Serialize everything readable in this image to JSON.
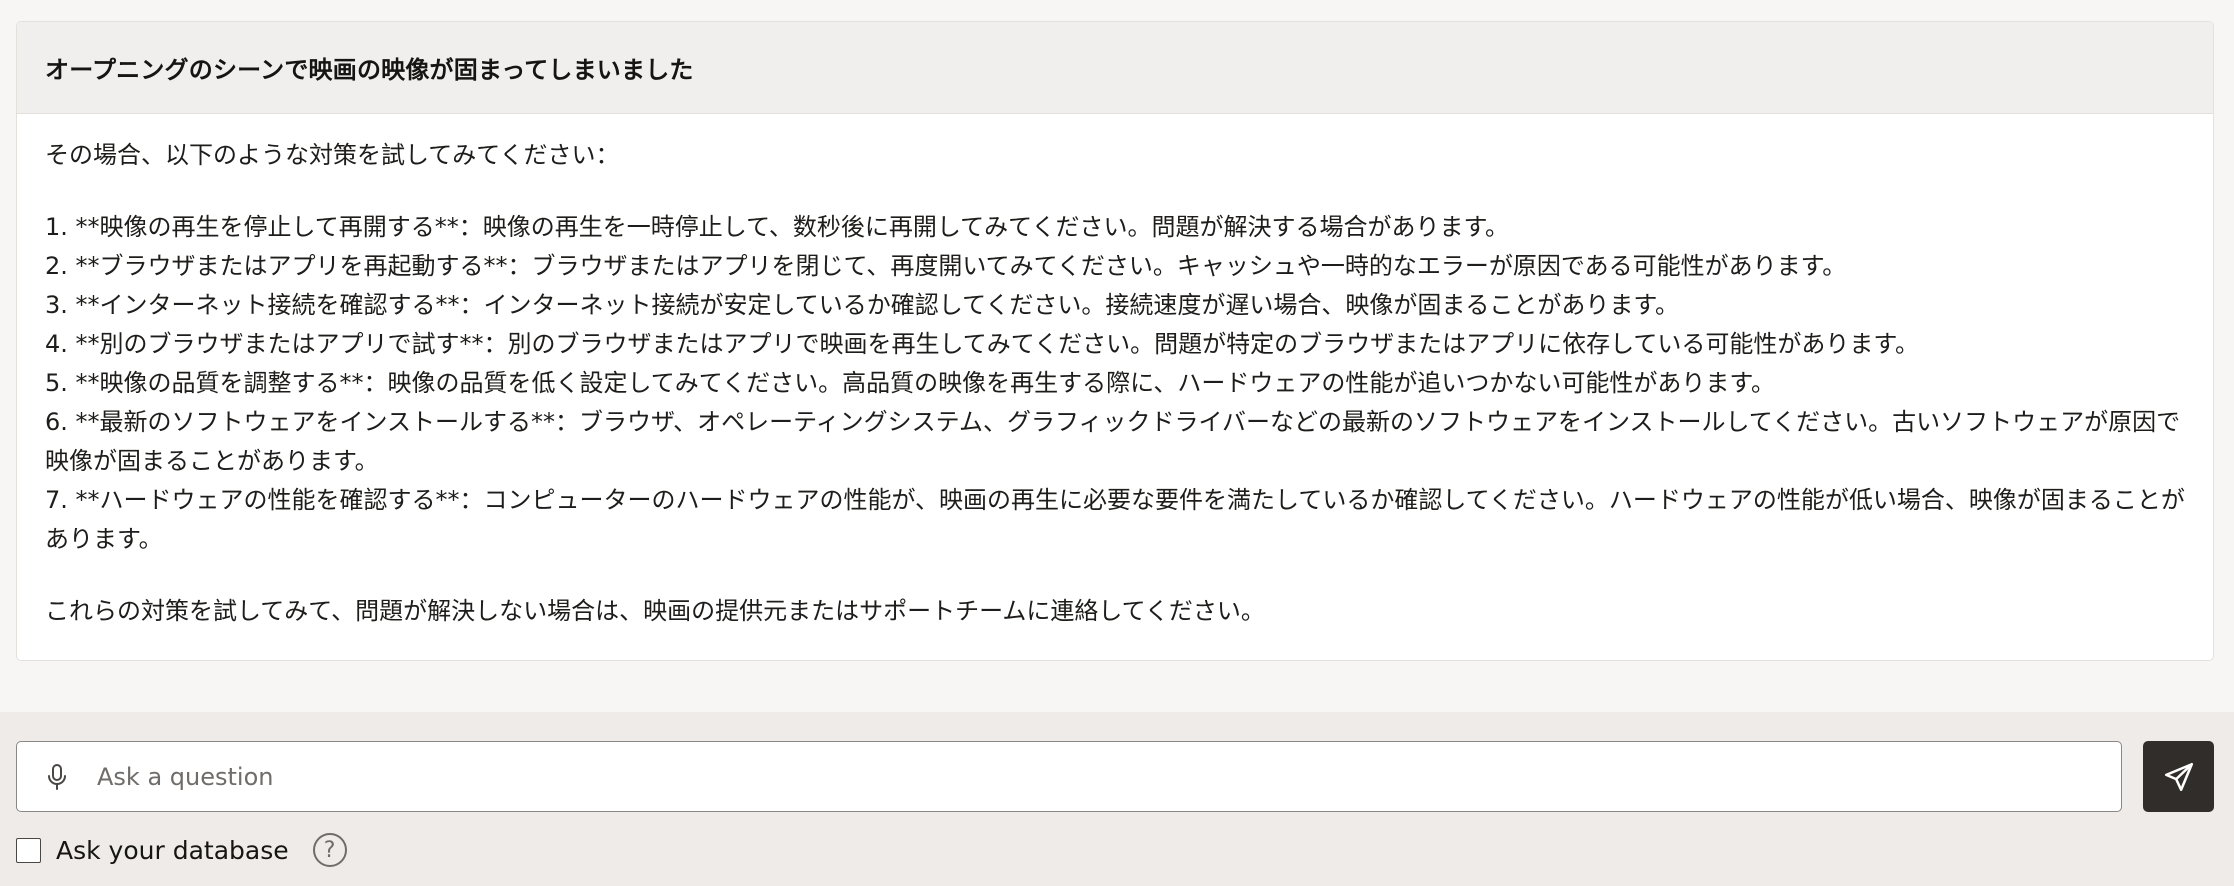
{
  "conversation": {
    "question": "オープニングのシーンで映画の映像が固まってしまいました",
    "answer": {
      "intro": "その場合、以下のような対策を試してみてください：",
      "items": [
        "1. **映像の再生を停止して再開する**：映像の再生を一時停止して、数秒後に再開してみてください。問題が解決する場合があります。",
        "2. **ブラウザまたはアプリを再起動する**：ブラウザまたはアプリを閉じて、再度開いてみてください。キャッシュや一時的なエラーが原因である可能性があります。",
        "3. **インターネット接続を確認する**：インターネット接続が安定しているか確認してください。接続速度が遅い場合、映像が固まることがあります。",
        "4. **別のブラウザまたはアプリで試す**：別のブラウザまたはアプリで映画を再生してみてください。問題が特定のブラウザまたはアプリに依存している可能性があります。",
        "5. **映像の品質を調整する**：映像の品質を低く設定してみてください。高品質の映像を再生する際に、ハードウェアの性能が追いつかない可能性があります。",
        "6. **最新のソフトウェアをインストールする**：ブラウザ、オペレーティングシステム、グラフィックドライバーなどの最新のソフトウェアをインストールしてください。古いソフトウェアが原因で映像が固まることがあります。",
        "7. **ハードウェアの性能を確認する**：コンピューターのハードウェアの性能が、映画の再生に必要な要件を満たしているか確認してください。ハードウェアの性能が低い場合、映像が固まることがあります。"
      ],
      "outro": "これらの対策を試してみて、問題が解決しない場合は、映画の提供元またはサポートチームに連絡してください。"
    }
  },
  "input": {
    "placeholder": "Ask a question",
    "value": "",
    "mic_icon": "microphone-icon",
    "send_icon": "paper-plane-icon"
  },
  "options": {
    "ask_database_label": "Ask your database",
    "ask_database_checked": false,
    "help_icon": "question-circle-icon",
    "help_glyph": "?"
  },
  "colors": {
    "send_button_bg": "#312d2a",
    "question_header_bg": "#f1efed",
    "input_area_bg": "#eeebe8"
  }
}
